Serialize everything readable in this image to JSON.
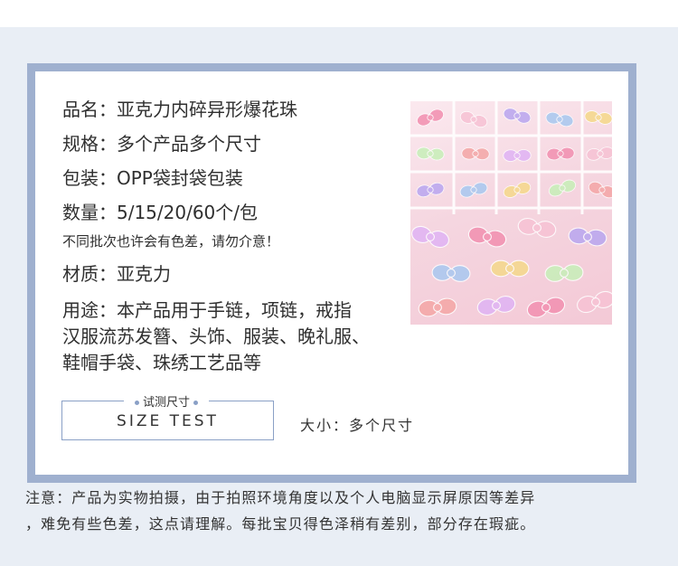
{
  "specs": {
    "name": "品名：亚克力内碎异形爆花珠",
    "spec": "规格：多个产品多个尺寸",
    "package": "包装：OPP袋封袋包装",
    "quantity": "数量：5/15/20/60个/包",
    "color_note": "不同批次也许会有色差，请勿介意！",
    "material": "材质：亚克力",
    "usage": [
      "用途：本产品用于手链，项链，戒指",
      "汉服流苏发簪、头饰、服装、晚礼服、",
      "鞋帽手袋、珠绣工艺品等"
    ]
  },
  "size_test": {
    "caption": "试测尺寸",
    "text": "SIZE TEST",
    "label": "大小：多个尺寸"
  },
  "note": [
    "注意：产品为实物拍摄，由于拍照环境角度以及个人电脑显示屏原因等差异",
    "，难免有些色差，这点请理解。每批宝贝得色泽稍有差别，部分存在瑕疵。"
  ],
  "colors": {
    "frame": "#9fb0cf",
    "background": "#e9eef5"
  },
  "photo": {
    "subject": "acrylic-bow-beads-photo"
  }
}
